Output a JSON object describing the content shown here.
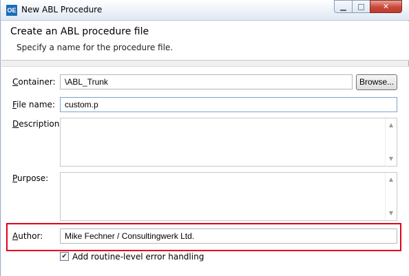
{
  "window": {
    "app_icon_text": "OE",
    "title": "New ABL Procedure",
    "minimize_glyph": "▁",
    "maximize_glyph": "□",
    "close_glyph": "✕"
  },
  "header": {
    "title": "Create an ABL procedure file",
    "subtitle": "Specify a name for the procedure file."
  },
  "form": {
    "container": {
      "label_key": "C",
      "label_rest": "ontainer:",
      "value": "\\ABL_Trunk"
    },
    "browse_label": "Browse...",
    "file_name": {
      "label_key": "F",
      "label_rest": "ile name:",
      "value": "custom.p"
    },
    "description": {
      "label_key": "D",
      "label_rest": "escription:",
      "value": ""
    },
    "purpose": {
      "label_key": "P",
      "label_rest": "urpose:",
      "value": ""
    },
    "author": {
      "label_key": "A",
      "label_rest": "uthor:",
      "value": "Mike Fechner / Consultingwerk Ltd."
    },
    "error_handling": {
      "checked": true,
      "check_glyph": "✔",
      "label": "Add routine-level error handling"
    }
  },
  "scroll": {
    "up_glyph": "▲",
    "down_glyph": "▼"
  },
  "colors": {
    "highlight": "#e2001a",
    "icon_bg": "#1c6db7"
  },
  "icons": [
    "oe-app-icon",
    "minimize-icon",
    "maximize-icon",
    "close-icon",
    "scroll-up-icon",
    "scroll-down-icon",
    "checkbox-check-icon"
  ]
}
